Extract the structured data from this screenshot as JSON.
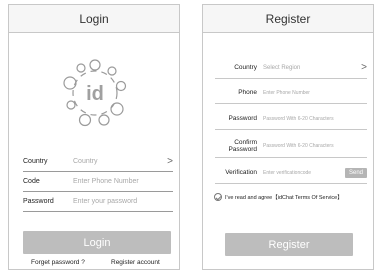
{
  "login": {
    "title": "Login",
    "fields": [
      {
        "label": "Country",
        "value": "Country",
        "chevron": ">"
      },
      {
        "label": "Code",
        "value": "Enter Phone Number"
      },
      {
        "label": "Password",
        "value": "Enter your password"
      }
    ],
    "login_button": "Login",
    "forgot_link": "Forget password ?",
    "register_link": "Register account",
    "logo_text": "id"
  },
  "register": {
    "title": "Register",
    "fields": [
      {
        "label": "Country",
        "value": "Select Region",
        "chevron": ">"
      },
      {
        "label": "Phone",
        "value": "Enter Phone Number"
      },
      {
        "label": "Password",
        "value": "Password With 6-20 Characters"
      },
      {
        "label": "Confirm Password",
        "value": "Password With 6-20 Characters"
      },
      {
        "label": "Verification",
        "value": "Enter verificationcode",
        "button": "Send"
      }
    ],
    "agreement": "I've read and agree【idChat Terms Of Service】",
    "register_button": "Register"
  },
  "colors": {
    "button_gray": "#bdbdbd",
    "border": "#c8c8c8",
    "placeholder": "#a8a8a8"
  },
  "icons": [
    "id-logo-icon",
    "chevron-right-icon",
    "check-circle-icon"
  ]
}
